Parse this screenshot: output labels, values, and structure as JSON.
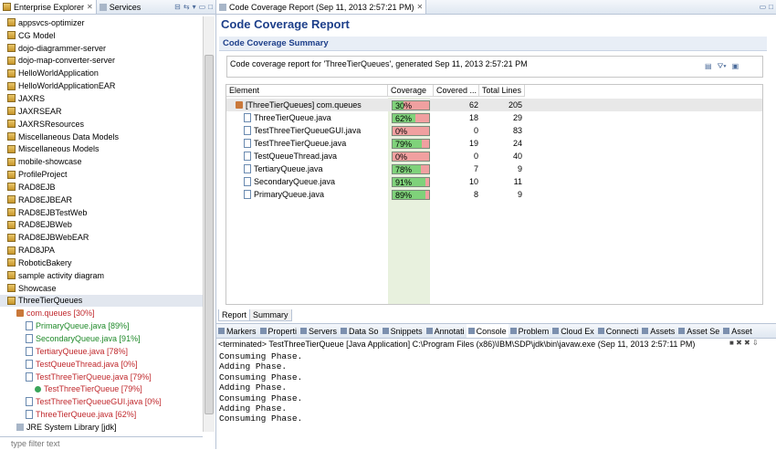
{
  "left_pane": {
    "tabs": [
      {
        "label": "Enterprise Explorer",
        "active": true
      },
      {
        "label": "Services",
        "active": false
      }
    ],
    "tree": [
      {
        "label": "appsvcs-optimizer",
        "indent": 0,
        "icon": "project-icon",
        "color": "black"
      },
      {
        "label": "CG Model",
        "indent": 0,
        "icon": "project-icon",
        "color": "black"
      },
      {
        "label": "dojo-diagrammer-server",
        "indent": 0,
        "icon": "project-icon",
        "color": "black"
      },
      {
        "label": "dojo-map-converter-server",
        "indent": 0,
        "icon": "project-icon",
        "color": "black"
      },
      {
        "label": "HelloWorldApplication",
        "indent": 0,
        "icon": "project-icon",
        "color": "black"
      },
      {
        "label": "HelloWorldApplicationEAR",
        "indent": 0,
        "icon": "project-icon",
        "color": "black"
      },
      {
        "label": "JAXRS",
        "indent": 0,
        "icon": "project-icon",
        "color": "black"
      },
      {
        "label": "JAXRSEAR",
        "indent": 0,
        "icon": "project-icon",
        "color": "black"
      },
      {
        "label": "JAXRSResources",
        "indent": 0,
        "icon": "project-icon",
        "color": "black"
      },
      {
        "label": "Miscellaneous Data Models",
        "indent": 0,
        "icon": "project-icon",
        "color": "black"
      },
      {
        "label": "Miscellaneous Models",
        "indent": 0,
        "icon": "project-icon",
        "color": "black"
      },
      {
        "label": "mobile-showcase",
        "indent": 0,
        "icon": "project-icon",
        "color": "black"
      },
      {
        "label": "ProfileProject",
        "indent": 0,
        "icon": "project-icon",
        "color": "black"
      },
      {
        "label": "RAD8EJB",
        "indent": 0,
        "icon": "project-icon",
        "color": "black"
      },
      {
        "label": "RAD8EJBEAR",
        "indent": 0,
        "icon": "project-icon",
        "color": "black"
      },
      {
        "label": "RAD8EJBTestWeb",
        "indent": 0,
        "icon": "project-icon",
        "color": "black"
      },
      {
        "label": "RAD8EJBWeb",
        "indent": 0,
        "icon": "project-icon",
        "color": "black"
      },
      {
        "label": "RAD8EJBWebEAR",
        "indent": 0,
        "icon": "project-icon",
        "color": "black"
      },
      {
        "label": "RAD8JPA",
        "indent": 0,
        "icon": "project-icon",
        "color": "black"
      },
      {
        "label": "RoboticBakery",
        "indent": 0,
        "icon": "project-icon",
        "color": "black"
      },
      {
        "label": "sample activity diagram",
        "indent": 0,
        "icon": "project-icon",
        "color": "black"
      },
      {
        "label": "Showcase",
        "indent": 0,
        "icon": "project-icon",
        "color": "black"
      },
      {
        "label": "ThreeTierQueues",
        "indent": 0,
        "icon": "project-icon",
        "color": "black",
        "selected": true
      },
      {
        "label": "com.queues [30%]",
        "indent": 1,
        "icon": "package-icon",
        "color": "red"
      },
      {
        "label": "PrimaryQueue.java [89%]",
        "indent": 2,
        "icon": "java-file-icon",
        "color": "green"
      },
      {
        "label": "SecondaryQueue.java [91%]",
        "indent": 2,
        "icon": "java-file-icon",
        "color": "green"
      },
      {
        "label": "TertiaryQueue.java [78%]",
        "indent": 2,
        "icon": "java-file-icon",
        "color": "red"
      },
      {
        "label": "TestQueueThread.java [0%]",
        "indent": 2,
        "icon": "java-file-icon",
        "color": "red"
      },
      {
        "label": "TestThreeTierQueue.java [79%]",
        "indent": 2,
        "icon": "java-file-icon",
        "color": "red"
      },
      {
        "label": "TestThreeTierQueue [79%]",
        "indent": 3,
        "icon": "class-icon",
        "color": "red"
      },
      {
        "label": "TestThreeTierQueueGUI.java [0%]",
        "indent": 2,
        "icon": "java-file-icon",
        "color": "red"
      },
      {
        "label": "ThreeTierQueue.java [62%]",
        "indent": 2,
        "icon": "java-file-icon",
        "color": "red"
      },
      {
        "label": "JRE System Library [jdk]",
        "indent": 1,
        "icon": "library-icon",
        "color": "black"
      }
    ],
    "filter_placeholder": "type filter text"
  },
  "editor": {
    "tab_label": "Code Coverage Report (Sep 11, 2013 2:57:21 PM)",
    "title": "Code Coverage Report",
    "section_title": "Code Coverage Summary",
    "description": "Code coverage report for 'ThreeTierQueues', generated Sep 11, 2013 2:57:21 PM",
    "columns": [
      "Element",
      "Coverage",
      "Covered ...",
      "Total Lines"
    ],
    "rows": [
      {
        "element": "[ThreeTierQueues] com.queues",
        "coverage": "30%",
        "coverage_value": 30,
        "covered": "62",
        "total": "205",
        "level": 0
      },
      {
        "element": "ThreeTierQueue.java",
        "coverage": "62%",
        "coverage_value": 62,
        "covered": "18",
        "total": "29",
        "level": 1
      },
      {
        "element": "TestThreeTierQueueGUI.java",
        "coverage": "0%",
        "coverage_value": 0,
        "covered": "0",
        "total": "83",
        "level": 1
      },
      {
        "element": "TestThreeTierQueue.java",
        "coverage": "79%",
        "coverage_value": 79,
        "covered": "19",
        "total": "24",
        "level": 1
      },
      {
        "element": "TestQueueThread.java",
        "coverage": "0%",
        "coverage_value": 0,
        "covered": "0",
        "total": "40",
        "level": 1
      },
      {
        "element": "TertiaryQueue.java",
        "coverage": "78%",
        "coverage_value": 78,
        "covered": "7",
        "total": "9",
        "level": 1
      },
      {
        "element": "SecondaryQueue.java",
        "coverage": "91%",
        "coverage_value": 91,
        "covered": "10",
        "total": "11",
        "level": 1
      },
      {
        "element": "PrimaryQueue.java",
        "coverage": "89%",
        "coverage_value": 89,
        "covered": "8",
        "total": "9",
        "level": 1
      }
    ],
    "bottom_tabs": [
      "Report",
      "Summary"
    ]
  },
  "console": {
    "tabs": [
      "Markers",
      "Properti",
      "Servers",
      "Data So",
      "Snippets",
      "Annotati",
      "Console",
      "Problem",
      "Cloud Ex",
      "Connecti",
      "Assets",
      "Asset Se",
      "Asset"
    ],
    "active_tab": "Console",
    "status": "<terminated> TestThreeTierQueue [Java Application] C:\\Program Files (x86)\\IBM\\SDP\\jdk\\bin\\javaw.exe (Sep 11, 2013 2:57:11 PM)",
    "output": [
      "Consuming Phase.",
      "Adding Phase.",
      "Consuming Phase.",
      "Adding Phase.",
      "Consuming Phase.",
      "Adding Phase.",
      "Consuming Phase."
    ]
  },
  "colors": {
    "title_blue": "#1d3f8a",
    "covered_green": "#7fd27a",
    "uncovered_red": "#f0a0a0",
    "low_coverage_text": "#c0282c",
    "high_coverage_text": "#208a2a"
  }
}
